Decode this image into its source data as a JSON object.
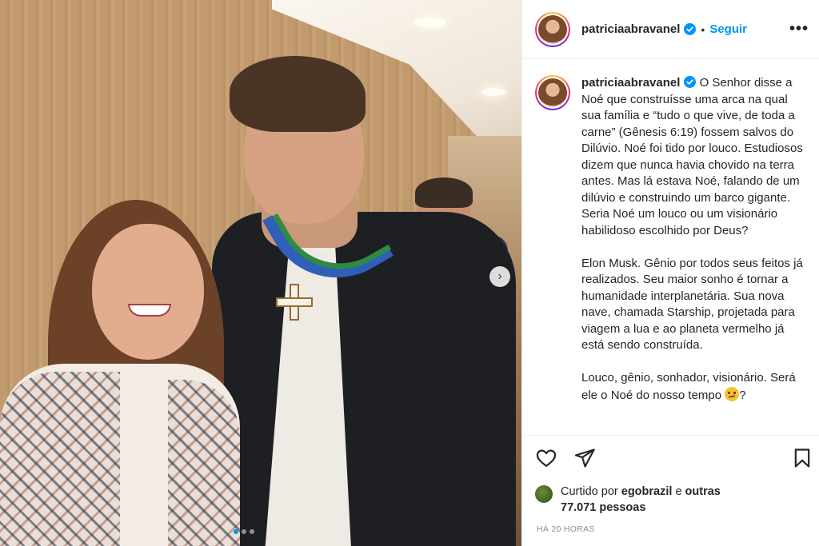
{
  "post": {
    "username": "patriciaabravanel",
    "separator": "•",
    "follow_label": "Seguir",
    "more_icon": "•••",
    "next_icon": "›",
    "caption": "O Senhor disse a Noé que construísse uma arca na qual sua família e “tudo o que vive, de toda a carne” (Gênesis 6:19) fossem salvos do Dilúvio. Noé foi tido por louco. Estudiosos dizem que nunca havia chovido na terra antes. Mas lá estava Noé, falando de um dilúvio e construindo um barco gigante. Seria Noé um louco ou um visionário habilidoso escolhido por Deus?\n\nElon Musk. Gênio por todos seus feitos já realizados. Seu maior sonho é tornar a humanidade interplanetária. Sua nova nave, chamada Starship, projetada para viagem a lua e ao planeta vermelho já está sendo construída.\n\nLouco, gênio, sonhador, visionário. Será ele o Noé do nosso tempo ",
    "caption_end": "?",
    "likes": {
      "prefix": "Curtido por ",
      "liker": "egobrazil",
      "middle": " e ",
      "count_text": "outras 77.071 pessoas"
    },
    "timestamp": "HÁ 20 HORAS",
    "carousel": {
      "slides": 3,
      "active_index": 0
    }
  },
  "colors": {
    "accent": "#0095f6",
    "text": "#262626",
    "muted": "#8e8e8e",
    "border": "#efefef"
  },
  "icons": {
    "verified": "verified-badge-icon",
    "like": "heart-icon",
    "share": "paper-plane-icon",
    "save": "bookmark-icon",
    "more": "more-options-icon",
    "next": "chevron-right-icon",
    "emoji": "thinking-face-emoji"
  }
}
